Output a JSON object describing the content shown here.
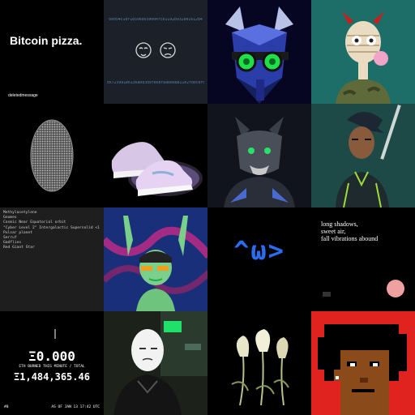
{
  "gallery": {
    "pizza": {
      "title": "Bitcoin pizza.",
      "footer": "deletedmessage"
    },
    "hashes": {
      "top": "0x054c1df18596d65b0d4fc61192b932b0161284",
      "bottom": "0x723991e6136a083d9fe6bf8abe88811e2fd0cefd"
    },
    "list": {
      "lines": [
        "Methylacetylene",
        "Gnomes",
        "Cosmic Near Equatorial orbit",
        "\"Cyber Level 2\" Intergalactic Supersolid <1",
        "Pulsar planet",
        "Serruf",
        "Gadflies",
        "Red Giant Star"
      ]
    },
    "ascii": {
      "text": "^ω>"
    },
    "poem": {
      "lines": [
        "long shadows,",
        "sweet air,",
        "fall vibrations abound"
      ]
    },
    "burn": {
      "value": "Ξ0.000",
      "caption": "ETH BURNED THIS MINUTE / TOTAL",
      "total": "Ξ1,484,365.46",
      "corner": "#0",
      "date": "AS OF JAN 13 17:42 UTC"
    }
  },
  "colors": {
    "hash_bg": "#1c2029",
    "teal_bg": "#1d6e68",
    "ascii_blue": "#2b6df0",
    "punk_bg": "#e0231e"
  }
}
